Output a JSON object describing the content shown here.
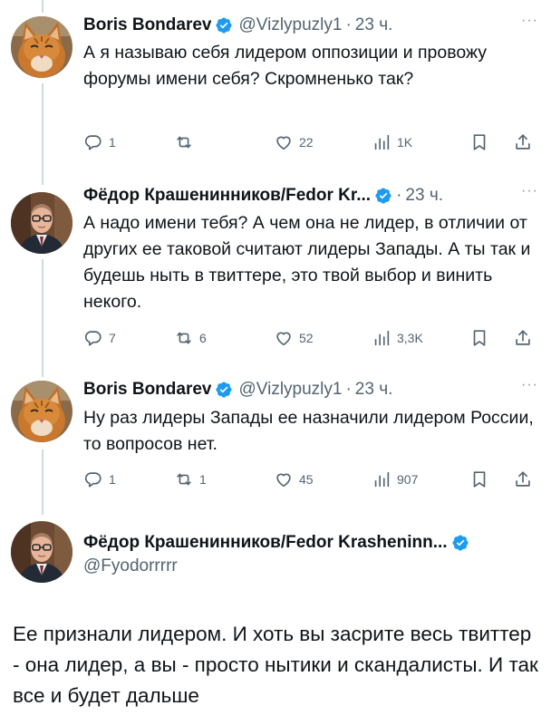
{
  "tweets": [
    {
      "name": "Boris Bondarev",
      "handle": "@Vizlypuzly1",
      "sep": "·",
      "time": "23 ч.",
      "more": "···",
      "text": "А я называю себя лидером оппозиции и провожу форумы имени себя? Скромненько так?",
      "avatar_icon": "cat-avatar-icon",
      "stats": {
        "replies": "1",
        "reposts": "",
        "likes": "22",
        "views": "1K"
      }
    },
    {
      "name": "Фёдор Крашенинников/Fedor Kr...",
      "handle": "",
      "sep": "·",
      "time": "23 ч.",
      "more": "···",
      "text": "А надо имени тебя? А чем она не лидер, в отличии от других ее таковой считают лидеры Запады. А ты так и будешь ныть в твиттере, это  твой выбор и винить некого.",
      "avatar_icon": "man-avatar-icon",
      "stats": {
        "replies": "7",
        "reposts": "6",
        "likes": "52",
        "views": "3,3K"
      }
    },
    {
      "name": "Boris Bondarev",
      "handle": "@Vizlypuzly1",
      "sep": "·",
      "time": "23 ч.",
      "more": "···",
      "text": "Ну раз лидеры Запады ее назначили лидером России, то вопросов нет.",
      "avatar_icon": "cat-avatar-icon",
      "stats": {
        "replies": "1",
        "reposts": "1",
        "likes": "45",
        "views": "907"
      }
    }
  ],
  "main_tweet": {
    "name": "Фёдор Крашенинников/Fedor Krasheninn...",
    "handle": "@Fyodorrrrr",
    "text": "Ее признали лидером. И хоть вы засрите весь твиттер - она лидер, а вы - просто нытики и скандалисты. И так все и будет дальше",
    "avatar_icon": "man-avatar-icon"
  },
  "colors": {
    "accent": "#1d9bf0",
    "secondary_text": "#536471",
    "thread_line": "#cfd9de"
  }
}
